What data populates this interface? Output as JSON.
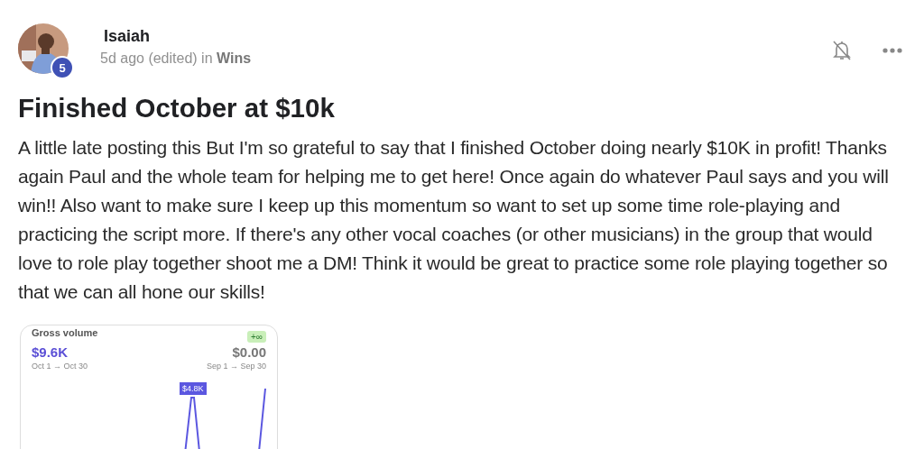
{
  "author": {
    "name": "Isaiah",
    "level": "5"
  },
  "meta": {
    "time": "5d ago (edited) in ",
    "category": "Wins"
  },
  "actions": {
    "notifications_muted": true
  },
  "post": {
    "title": "Finished October at $10k",
    "body": "A little late posting this But I'm so grateful to say that I finished October doing nearly $10K in profit! Thanks again Paul and the whole team for helping me to get here! Once again do whatever Paul says and you will win!! Also want to make sure I keep up this momentum so want to set up some time role-playing and practicing the script more. If there's any other vocal coaches (or other musicians) in the group that would love to role play together shoot me a DM! Think it would be great to practice some role playing together so that we can all hone our skills!"
  },
  "attachment": {
    "title": "Gross volume",
    "badge": "+∞",
    "current": {
      "value": "$9.6K",
      "range": "Oct 1 → Oct 30"
    },
    "previous": {
      "value": "$0.00",
      "range": "Sep 1 → Sep 30"
    },
    "peak_label": "$4.8K"
  }
}
